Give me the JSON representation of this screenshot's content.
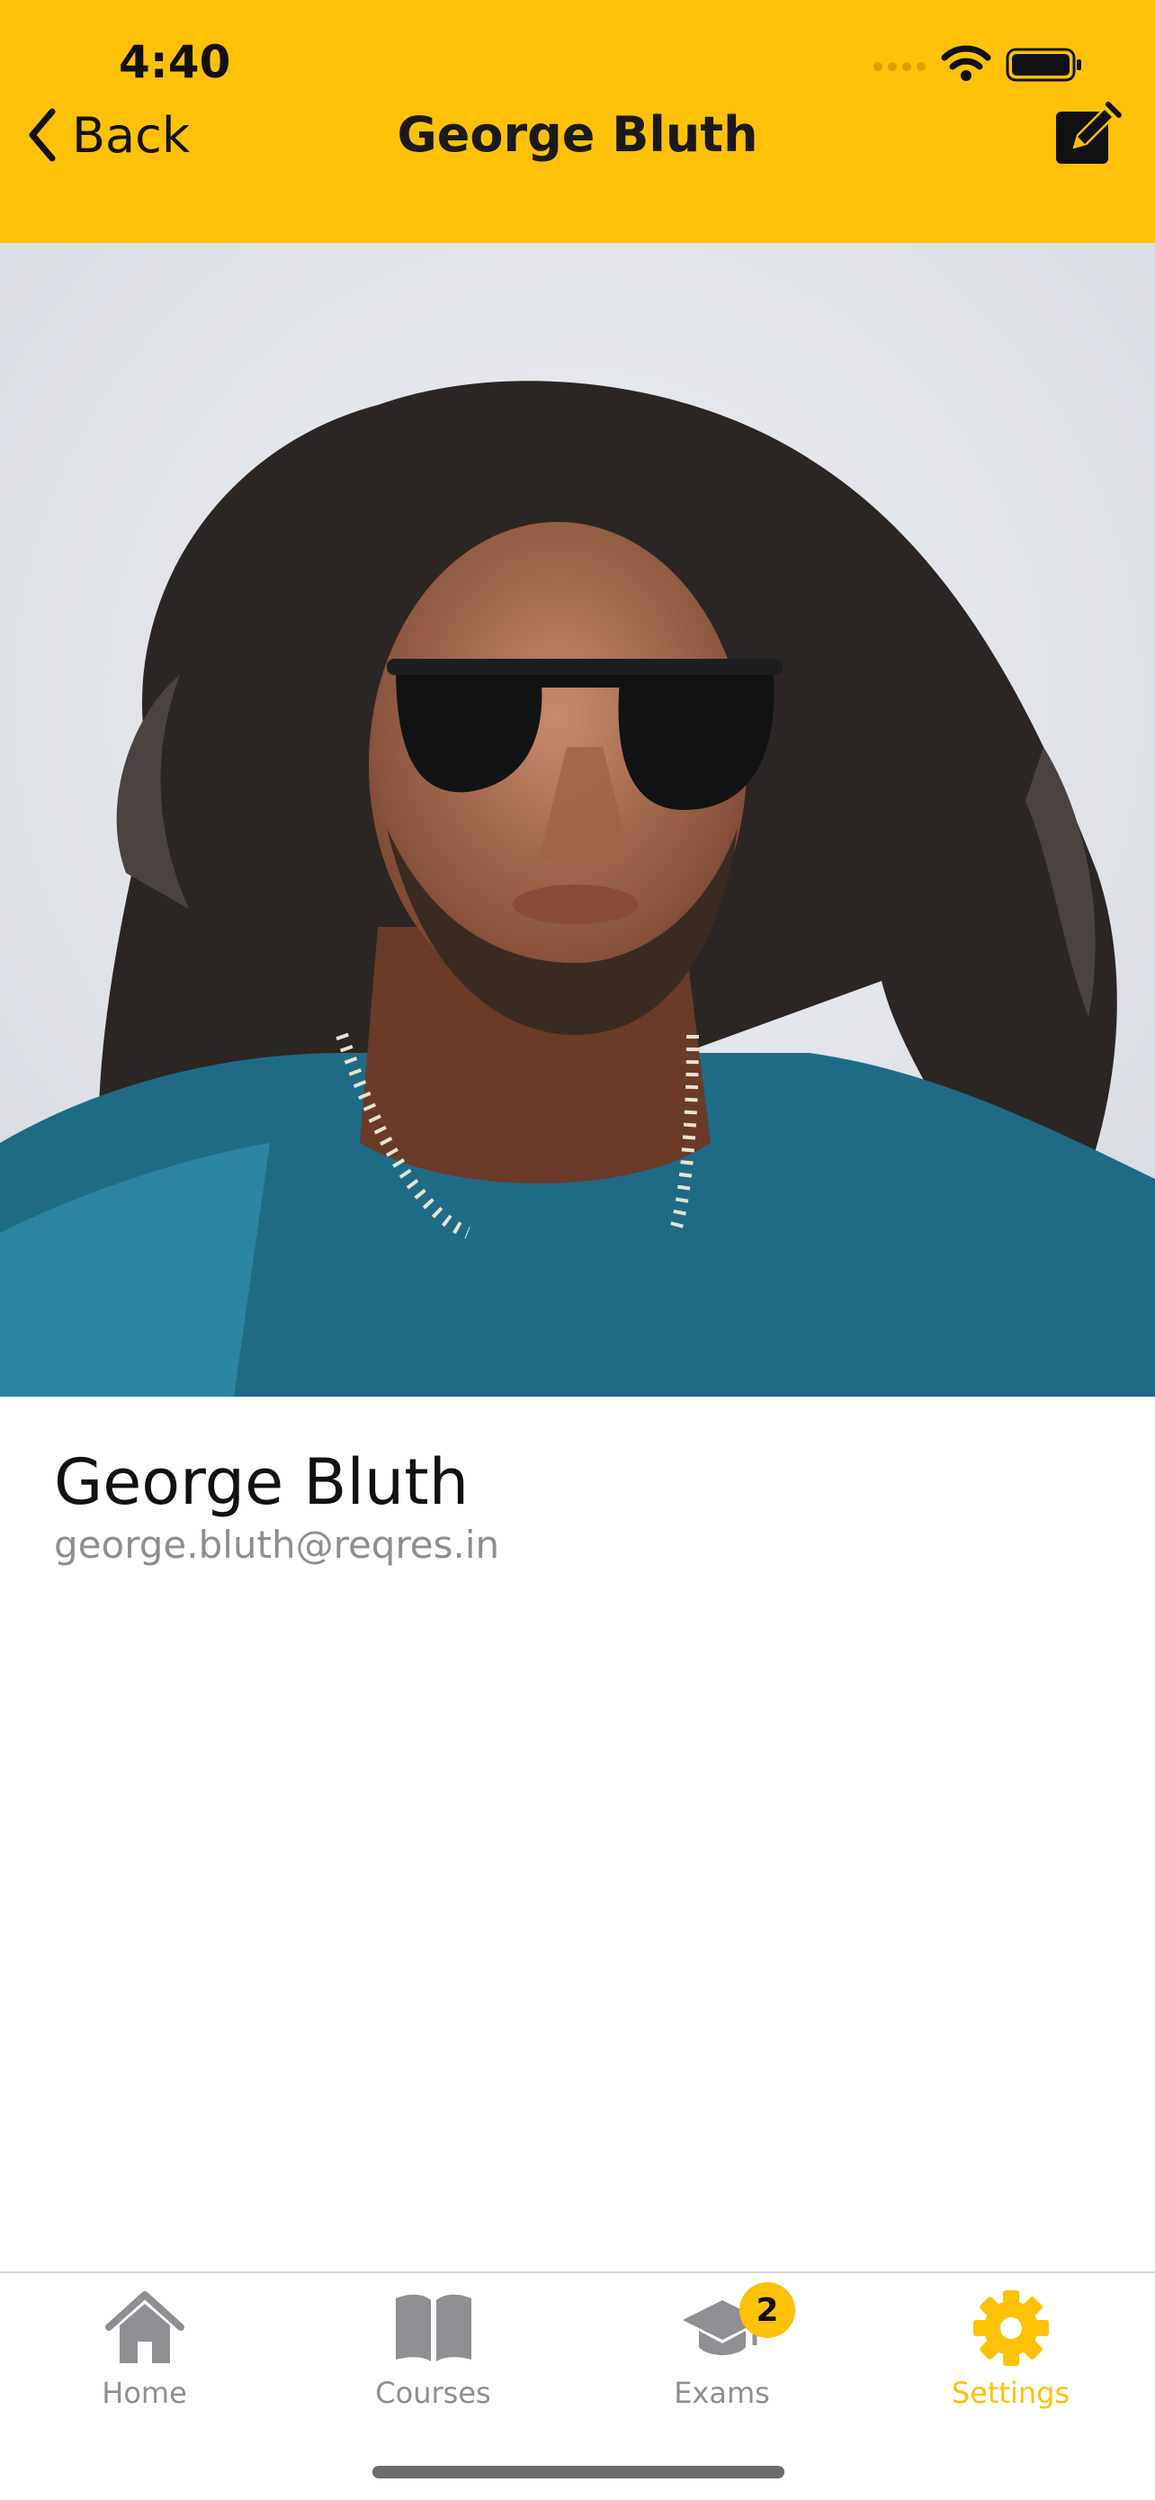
{
  "status_bar": {
    "time": "4:40"
  },
  "nav": {
    "back_label": "Back",
    "title": "George Bluth"
  },
  "profile": {
    "name": "George Bluth",
    "email": "george.bluth@reqres.in"
  },
  "tabs": [
    {
      "label": "Home",
      "icon": "home-icon",
      "active": false
    },
    {
      "label": "Courses",
      "icon": "book-icon",
      "active": false
    },
    {
      "label": "Exams",
      "icon": "graduation-cap-icon",
      "active": false,
      "badge": "2"
    },
    {
      "label": "Settings",
      "icon": "gear-icon",
      "active": true
    }
  ],
  "colors": {
    "accent": "#FFC107",
    "inactive": "#8e8e93"
  }
}
